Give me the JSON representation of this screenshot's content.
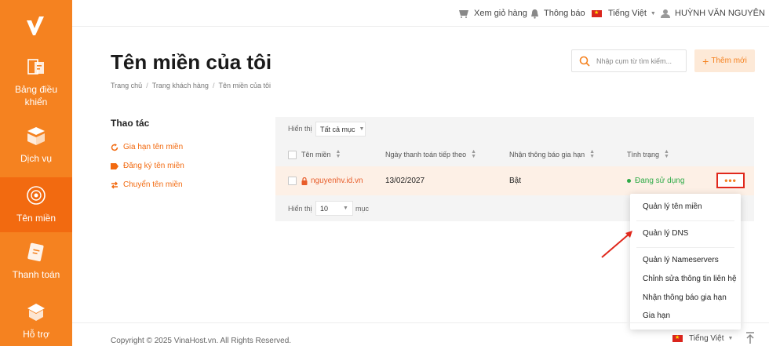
{
  "sidebar": {
    "logo_icon": "checkmark-logo-icon",
    "items": [
      {
        "label": "Bảng điều khiển",
        "icon": "dashboard-icon",
        "active": false
      },
      {
        "label": "Dịch vụ",
        "icon": "box-icon",
        "active": false
      },
      {
        "label": "Tên miền",
        "icon": "globe-icon",
        "active": true
      },
      {
        "label": "Thanh toán",
        "icon": "payment-icon",
        "active": false
      },
      {
        "label": "Hỗ trợ",
        "icon": "support-icon",
        "active": false
      }
    ],
    "color": "#f58220",
    "active_color": "#f26a10"
  },
  "topbar": {
    "cart": "Xem giỏ hàng",
    "notifications": "Thông báo",
    "language": "Tiếng Việt",
    "user": "HUỲNH VĂN NGUYÊN"
  },
  "header": {
    "title": "Tên miền của tôi",
    "breadcrumb": [
      "Trang chủ",
      "Trang khách hàng",
      "Tên miền của tôi"
    ],
    "search_placeholder": "Nhập cụm từ tìm kiếm...",
    "new_button": "Thêm mới"
  },
  "actions": {
    "title": "Thao tác",
    "items": [
      "Gia hạn tên miền",
      "Đăng ký tên miền",
      "Chuyển tên miền"
    ]
  },
  "table": {
    "show_label": "Hiển thị",
    "filter_value": "Tất cả mục",
    "columns": [
      "Tên miền",
      "Ngày thanh toán tiếp theo",
      "Nhận thông báo gia hạn",
      "Tình trạng"
    ],
    "rows": [
      {
        "domain": "nguyenhv.id.vn",
        "next_payment": "13/02/2027",
        "renew_notice": "Bật",
        "status": "Đang sử dụng"
      }
    ],
    "more_label": "•••",
    "page_size_label": "Hiển thị",
    "page_size": "10",
    "page_size_suffix": "mục"
  },
  "dropdown": {
    "items": [
      "Quản lý tên miền",
      "Quản lý DNS",
      "Quản lý Nameservers",
      "Chỉnh sửa thông tin liên hệ",
      "Nhận thông báo gia hạn",
      "Gia hạn"
    ]
  },
  "footer": {
    "copyright": "Copyright © 2025 VinaHost.vn. All Rights Reserved.",
    "language": "Tiếng Việt"
  },
  "colors": {
    "accent": "#f58220",
    "link": "#e85d2a",
    "status_active": "#2eaa47",
    "highlight_border": "#e0281c"
  }
}
